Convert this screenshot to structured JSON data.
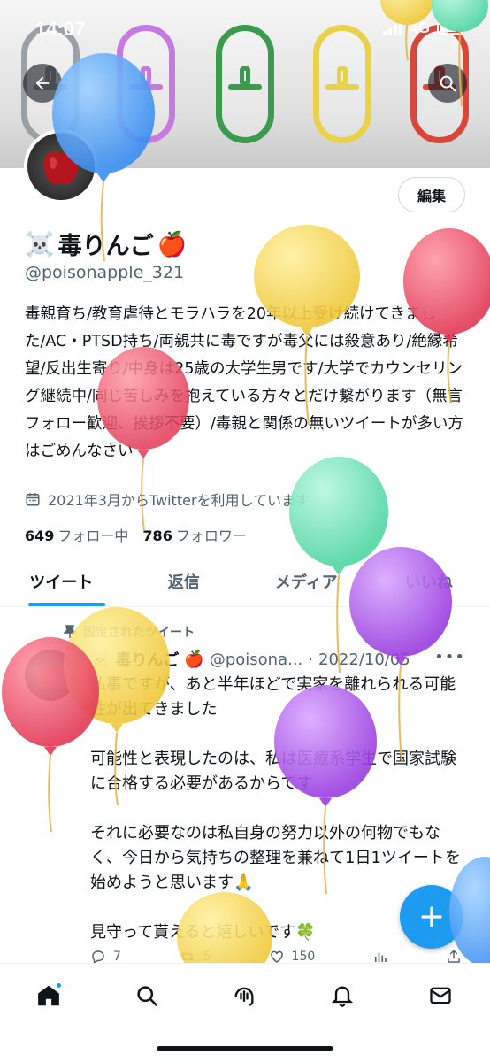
{
  "status_bar": {
    "time": "14:07",
    "network": "4G",
    "battery_percent": 80
  },
  "header": {
    "back_icon": "arrow-left-icon",
    "search_icon": "search-icon"
  },
  "profile": {
    "edit_label": "編集",
    "display_name": "毒りんご",
    "name_prefix_emoji": "☠️",
    "name_suffix_emoji": "🍎",
    "handle": "@poisonapple_321",
    "bio": "毒親育ち/教育虐待とモラハラを20年以上受け続けてきました/AC・PTSD持ち/両親共に毒ですが毒父には殺意あり/絶縁希望/反出生寄り/中身は25歳の大学生男です/大学でカウンセリング継続中/同じ苦しみを抱えている方々とだけ繋がります（無言フォロー歓迎、挨拶不要）/毒親と関係の無いツイートが多い方はごめんなさい",
    "joined": "2021年3月からTwitterを利用しています",
    "following_count": "649",
    "following_label": "フォロー中",
    "followers_count": "786",
    "followers_label": "フォロワー"
  },
  "tabs": [
    {
      "label": "ツイート",
      "active": true
    },
    {
      "label": "返信",
      "active": false
    },
    {
      "label": "メディア",
      "active": false
    },
    {
      "label": "いいね",
      "active": false
    }
  ],
  "pinned_tweet": {
    "pinned_label": "固定されたツイート",
    "author_name": "毒りんご",
    "author_handle": "@poisona...",
    "date": "2022/10/05",
    "separator": "·",
    "paragraphs": [
      "私事ですが、あと半年ほどで実家を離れられる可能性が出てきました",
      "可能性と表現したのは、私は医療系学生で国家試験に合格する必要があるからです",
      "それに必要なのは私自身の努力以外の何物でもなく、今日から気持ちの整理を兼ねて1日1ツイートを始めようと思います🙏",
      "見守って貰えると嬉しいです🍀"
    ],
    "replies": "7",
    "retweets": "5",
    "likes": "150"
  },
  "bottom_nav": [
    "home-icon",
    "search-icon",
    "spaces-icon",
    "notifications-icon",
    "messages-icon"
  ],
  "colors": {
    "accent": "#1d9bf0",
    "text": "#0f1419",
    "muted": "#536471"
  }
}
